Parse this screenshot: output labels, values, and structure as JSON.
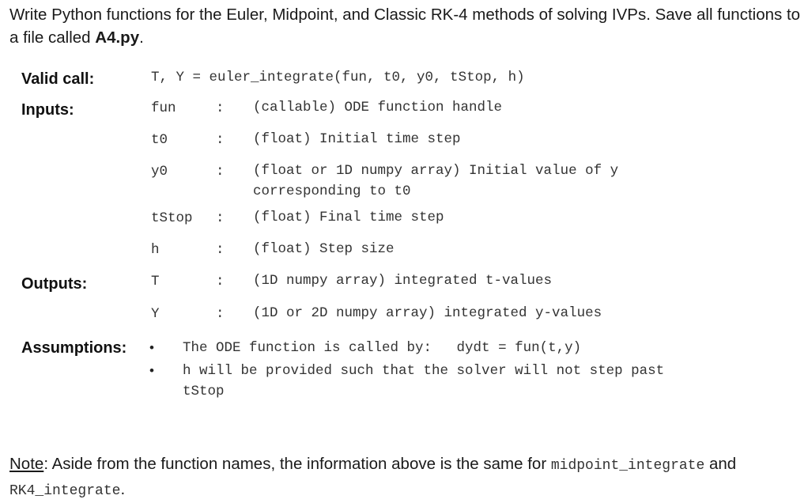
{
  "intro": {
    "text_before": "Write Python functions for the Euler, Midpoint, and Classic RK-4 methods of solving IVPs. Save all functions to a file called ",
    "filename": "A4.py",
    "text_after": "."
  },
  "spec": {
    "valid_call": {
      "label": "Valid call:",
      "code": "T, Y = euler_integrate(fun, t0, y0, tStop, h)"
    },
    "inputs": {
      "label": "Inputs:",
      "items": [
        {
          "name": "fun",
          "colon": ":",
          "desc": "(callable) ODE function handle"
        },
        {
          "name": "t0",
          "colon": ":",
          "desc": "(float) Initial time step"
        },
        {
          "name": "y0",
          "colon": ":",
          "desc": "(float or 1D numpy array) Initial value of y\ncorresponding to t0"
        },
        {
          "name": "tStop",
          "colon": ":",
          "desc": "(float) Final time step"
        },
        {
          "name": "h",
          "colon": ":",
          "desc": "(float) Step size"
        }
      ]
    },
    "outputs": {
      "label": "Outputs:",
      "items": [
        {
          "name": "T",
          "colon": ":",
          "desc": "(1D numpy array) integrated t-values"
        },
        {
          "name": "Y",
          "colon": ":",
          "desc": "(1D or 2D numpy array) integrated y-values"
        }
      ]
    },
    "assumptions": {
      "label": "Assumptions:",
      "bullet": "•",
      "items": [
        "The ODE function is called by:   dydt = fun(t,y)",
        "h will be provided such that the solver will not step past\ntStop"
      ]
    }
  },
  "note": {
    "label": "Note",
    "text1": ": Aside from the function names, the information above is the same for ",
    "func1": "midpoint_integrate",
    "text2": " and ",
    "func2": "RK4_integrate",
    "text3": "."
  }
}
